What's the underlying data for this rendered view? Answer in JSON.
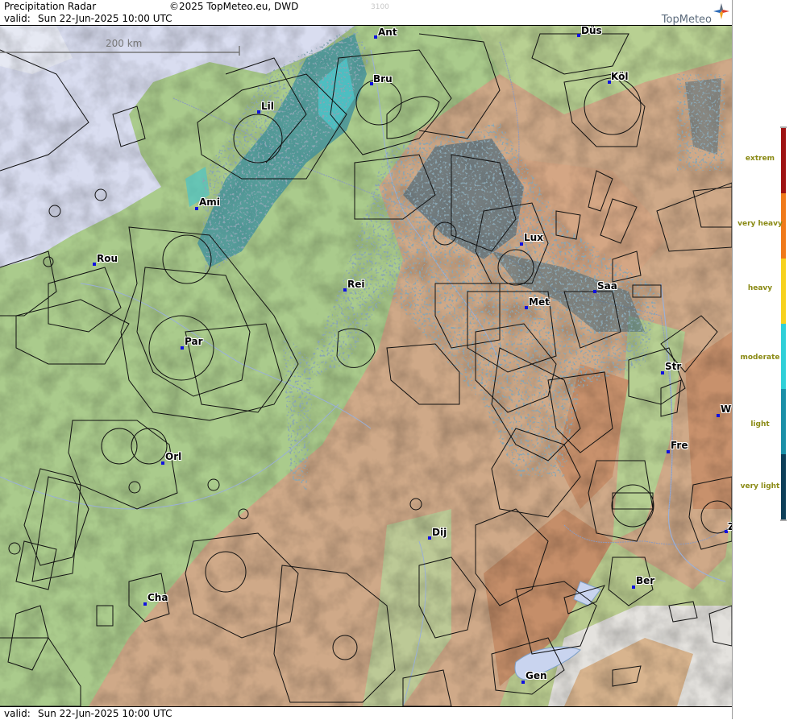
{
  "header": {
    "title": "Precipitation Radar",
    "copyright": "©2025 TopMeteo.eu, DWD",
    "valid_label": "valid:",
    "valid_time": "Sun  22-Jun-2025 10:00 UTC",
    "faint_number": "3100",
    "logo": "TopMeteo"
  },
  "footer": {
    "valid_label": "valid:",
    "valid_time": "Sun  22-Jun-2025 10:00 UTC"
  },
  "scale_bar": {
    "label": "200 km"
  },
  "cities": [
    {
      "name": "Ant"
    },
    {
      "name": "Düs"
    },
    {
      "name": "Bru"
    },
    {
      "name": "Köl"
    },
    {
      "name": "Lil"
    },
    {
      "name": "Ami"
    },
    {
      "name": "Lux"
    },
    {
      "name": "Rou"
    },
    {
      "name": "Rei"
    },
    {
      "name": "Saa"
    },
    {
      "name": "Met"
    },
    {
      "name": "Par"
    },
    {
      "name": "Str"
    },
    {
      "name": "W"
    },
    {
      "name": "Fre"
    },
    {
      "name": "Orl"
    },
    {
      "name": "Dij"
    },
    {
      "name": "Z"
    },
    {
      "name": "Ber"
    },
    {
      "name": "Cha"
    },
    {
      "name": "Gen"
    }
  ],
  "legend": {
    "levels": [
      {
        "label": "extrem",
        "color": "#9e1212"
      },
      {
        "label": "very heavy",
        "color": "#f07a1a"
      },
      {
        "label": "heavy",
        "color": "#f7d21e"
      },
      {
        "label": "moderate",
        "color": "#2fd0d8"
      },
      {
        "label": "light",
        "color": "#1a90a8"
      },
      {
        "label": "very light",
        "color": "#0d3e58"
      }
    ]
  },
  "colors": {
    "sea": "#d9ddf0",
    "lowland": "#a9c98a",
    "upland": "#d7b08c",
    "mountain": "#c79471",
    "alpine": "#e6e6e6",
    "radar_light": "#3a8c9e",
    "radar_moderate": "#4cc4c8",
    "radar_very_light": "#4d6a7a",
    "city_marker": "#1010e0"
  }
}
